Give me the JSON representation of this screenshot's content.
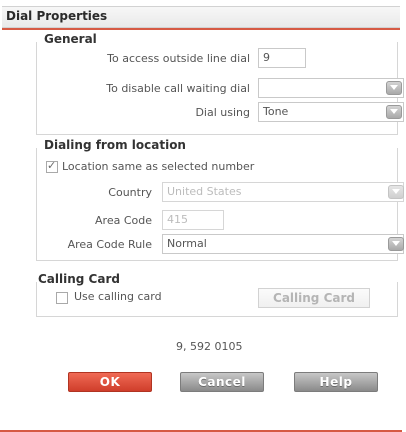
{
  "window": {
    "title": "Dial Properties"
  },
  "general": {
    "title": "General",
    "outside_line_label": "To access outside line dial",
    "outside_line_value": "9",
    "call_waiting_label": "To disable call waiting dial",
    "call_waiting_value": "",
    "dial_using_label": "Dial using",
    "dial_using_value": "Tone"
  },
  "location": {
    "title": "Dialing from location",
    "same_as_number_label": "Location same as selected number",
    "same_as_number_checked": true,
    "country_label": "Country",
    "country_value": "United States",
    "area_code_label": "Area Code",
    "area_code_value": "415",
    "area_code_rule_label": "Area Code Rule",
    "area_code_rule_value": "Normal"
  },
  "calling_card": {
    "title": "Calling Card",
    "use_card_label": "Use calling card",
    "use_card_checked": false,
    "button_label": "Calling Card"
  },
  "preview": {
    "number": "9, 592 0105"
  },
  "buttons": {
    "ok": "OK",
    "cancel": "Cancel",
    "help": "Help"
  },
  "colors": {
    "accent": "#d65a44",
    "primary_button": "#e0503c",
    "gray_button": "#a0a0a0"
  }
}
